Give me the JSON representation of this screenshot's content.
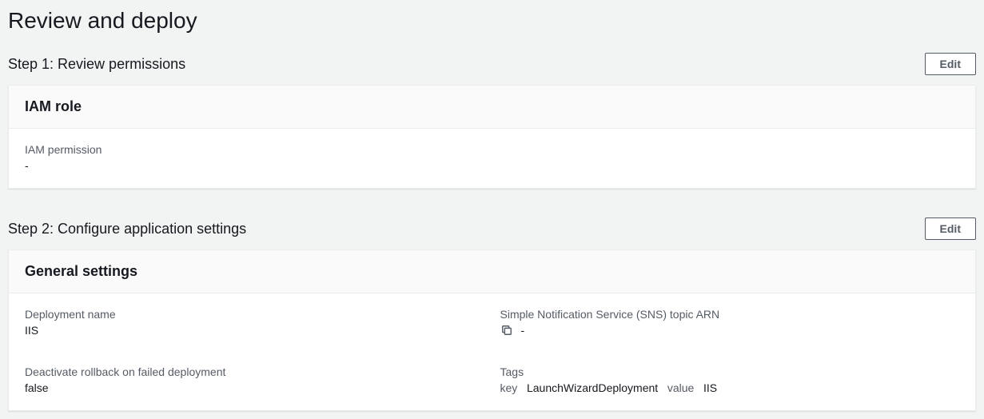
{
  "page": {
    "title": "Review and deploy"
  },
  "step1": {
    "title": "Step 1: Review permissions",
    "edit_label": "Edit",
    "panel": {
      "title": "IAM role",
      "iam_permission_label": "IAM permission",
      "iam_permission_value": "-"
    }
  },
  "step2": {
    "title": "Step 2: Configure application settings",
    "edit_label": "Edit",
    "panel": {
      "title": "General settings",
      "deployment_name_label": "Deployment name",
      "deployment_name_value": "IIS",
      "sns_label": "Simple Notification Service (SNS) topic ARN",
      "sns_value": "-",
      "rollback_label": "Deactivate rollback on failed deployment",
      "rollback_value": "false",
      "tags_label": "Tags",
      "tags_key_prefix": "key",
      "tags_key_value": "LaunchWizardDeployment",
      "tags_value_prefix": "value",
      "tags_value_value": "IIS"
    }
  }
}
